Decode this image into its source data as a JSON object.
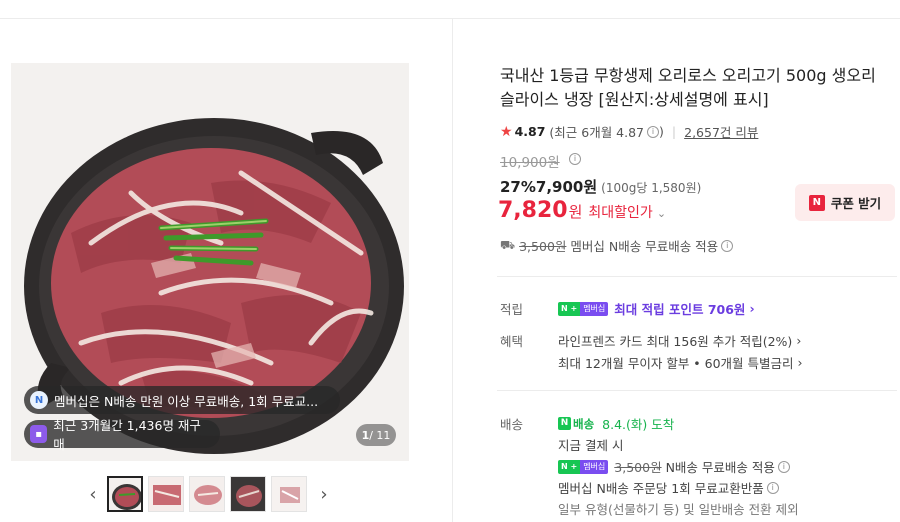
{
  "product": {
    "title": "국내산 1등급 무항생제 오리로스 오리고기 500g 생오리 슬라이스 냉장 [원산지:상세설명에 표시]",
    "rating": "4.87",
    "rating_detail": "(최근 6개월 4.87",
    "rating_detail_end": ")",
    "reviews": "2,657건 리뷰",
    "original_price": "10,900원",
    "discount_rate": "27%",
    "sale_price": "7,900원",
    "unit_price": "(100g당 1,580원)",
    "max_price_num": "7,820",
    "max_price_won": "원",
    "max_price_label": "최대할인가",
    "coupon_label": "쿠폰 받기",
    "shipping_old": "3,500원",
    "shipping_text": "멤버십 N배송 무료배송 적용"
  },
  "gallery": {
    "pill_membership": "멤버십은 N배송 만원 이상 무료배송, 1회 무료교...",
    "pill_repurchase": "최근 3개월간 1,436명 재구매",
    "counter_current": "1",
    "counter_total": "/ 11",
    "thumb_count": 5
  },
  "benefits": {
    "points_label": "적립",
    "points_badge_n": "N +",
    "points_badge_m": "멤버십",
    "points_text": "최대 적립 포인트 706원",
    "benefit_label": "혜택",
    "benefit_line1": "라인프렌즈 카드 최대 156원 추가 적립(2%)",
    "benefit_line2": "최대 12개월 무이자 할부 • 60개월 특별금리"
  },
  "delivery": {
    "label": "배송",
    "n_badge": "배송",
    "arrival": "8.4.(화) 도착",
    "pay_now": "지금 결제 시",
    "free_old": "3,500원",
    "free_text": "N배송 무료배송 적용",
    "exchange": "멤버십 N배송 주문당 1회 무료교환반품",
    "exclude": "일부 유형(선물하기 등) 및 일반배송 전환 제외"
  },
  "colors": {
    "accent_red": "#e8243d",
    "naver_green": "#17c653",
    "membership_purple": "#7a4df0"
  }
}
